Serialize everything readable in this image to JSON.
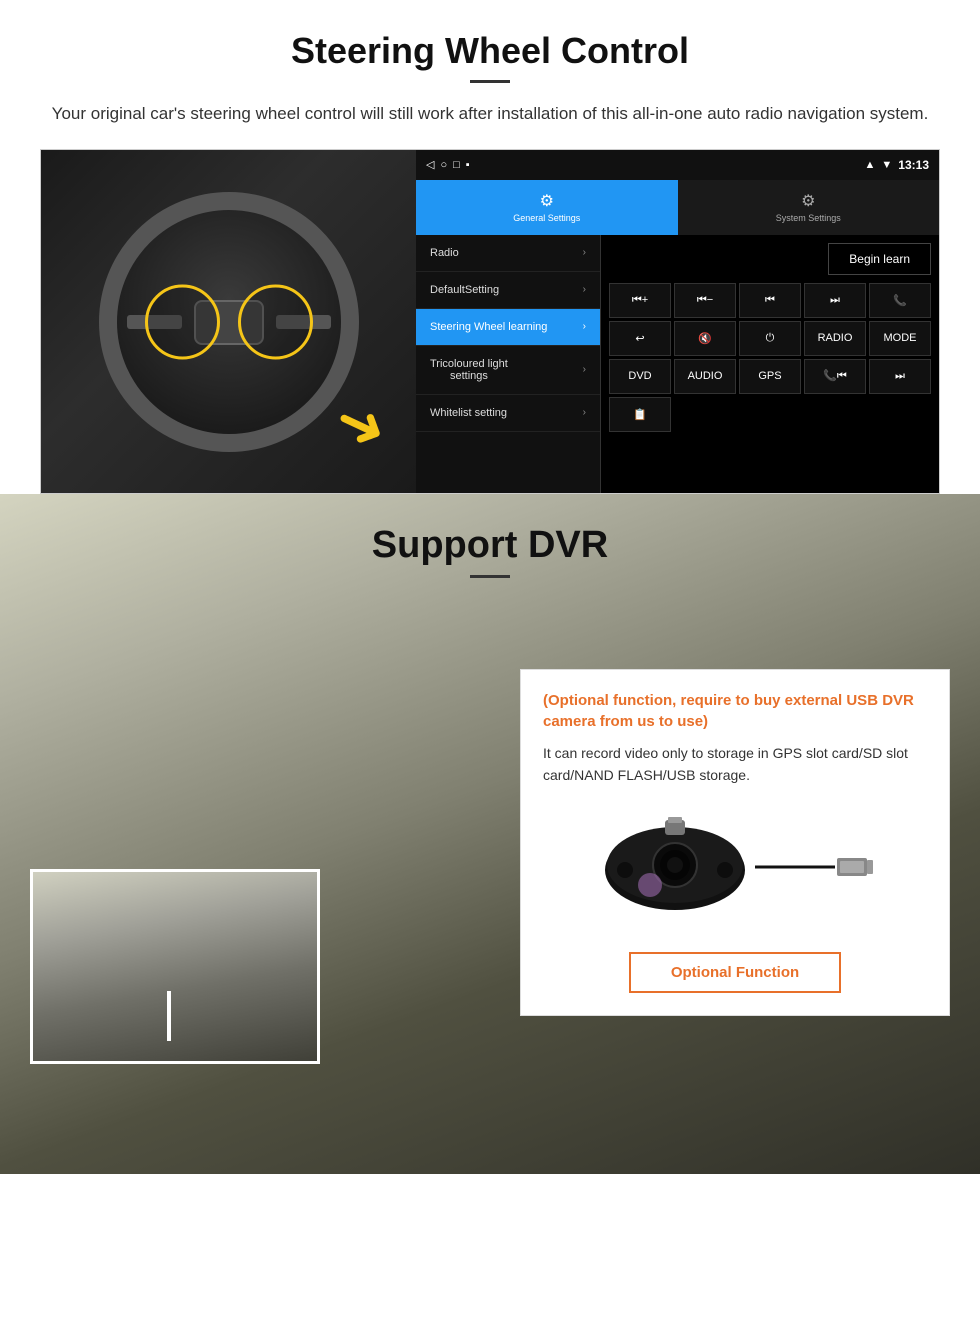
{
  "page": {
    "steering_section": {
      "title": "Steering Wheel Control",
      "subtitle": "Your original car's steering wheel control will still work after installation of this all-in-one auto radio navigation system.",
      "android_ui": {
        "status_bar": {
          "time": "13:13",
          "icons": [
            "◁",
            "○",
            "□",
            "▪"
          ]
        },
        "tabs": [
          {
            "icon": "⚙",
            "label": "General Settings",
            "active": true
          },
          {
            "icon": "⚙",
            "label": "System Settings",
            "active": false
          }
        ],
        "menu_items": [
          {
            "label": "Radio",
            "highlighted": false
          },
          {
            "label": "DefaultSetting",
            "highlighted": false
          },
          {
            "label": "Steering Wheel learning",
            "highlighted": true
          },
          {
            "label": "Tricoloured light settings",
            "highlighted": false
          },
          {
            "label": "Whitelist setting",
            "highlighted": false
          }
        ],
        "begin_learn_label": "Begin learn",
        "control_buttons": [
          "⏮+",
          "⏮-",
          "⏮",
          "⏭",
          "📞",
          "↩",
          "🔇",
          "⏻",
          "RADIO",
          "MODE",
          "DVD",
          "AUDIO",
          "GPS",
          "📞⏮",
          "⏭"
        ]
      }
    },
    "dvr_section": {
      "title": "Support DVR",
      "optional_text": "(Optional function, require to buy external USB DVR camera from us to use)",
      "description": "It can record video only to storage in GPS slot card/SD slot card/NAND FLASH/USB storage.",
      "optional_button_label": "Optional Function"
    }
  }
}
